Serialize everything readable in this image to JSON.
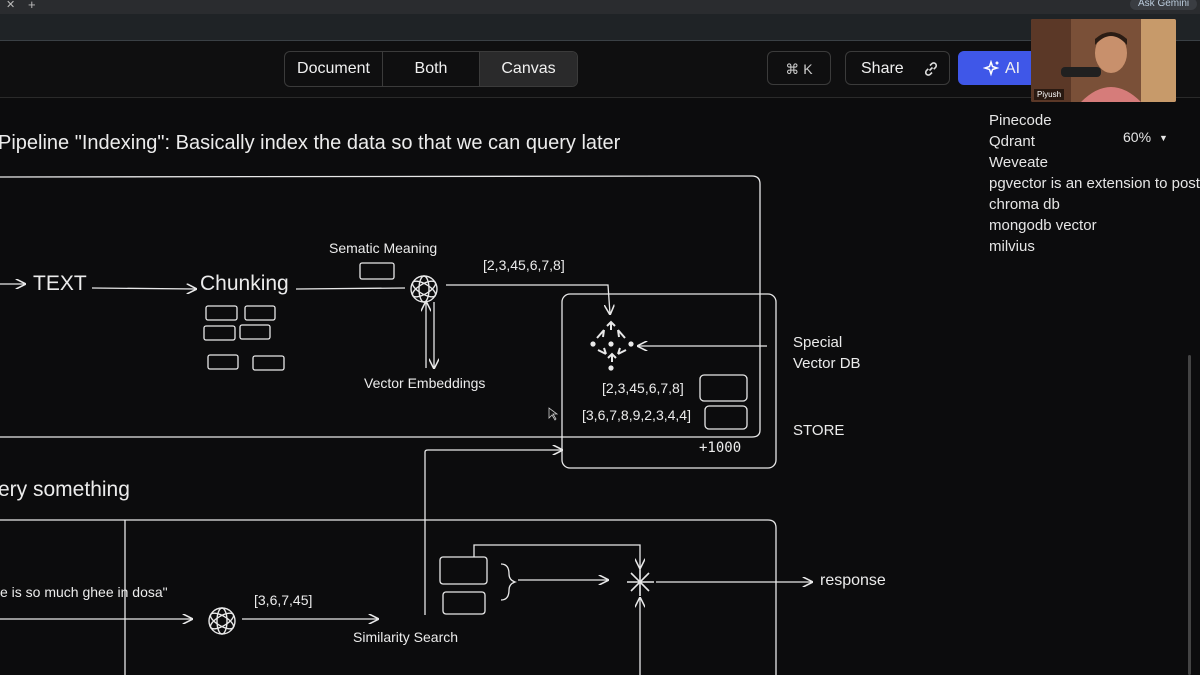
{
  "browser": {
    "ask_label": "Ask Gemini"
  },
  "toolbar": {
    "view_tabs": [
      "Document",
      "Both",
      "Canvas"
    ],
    "cmd_k_label": "⌘ K",
    "share_label": "Share",
    "ai_label": "AI"
  },
  "webcam": {
    "name": "Piyush"
  },
  "zoom": {
    "level": "60%"
  },
  "sidebar": {
    "items": [
      "Pinecode",
      "Qdrant",
      "Weveate",
      "pgvector is an extension to post",
      "chroma db",
      "mongodb vector",
      "milvius"
    ]
  },
  "diagram": {
    "title_indexing": "Pipeline \"Indexing\": Basically index the data so that we can query later",
    "text_node": "TEXT",
    "chunking_node": "Chunking",
    "semantic_label": "Sematic Meaning",
    "vector_out": "[2,3,45,6,7,8]",
    "vector_embeddings_label": "Vector Embeddings",
    "special_db_label": "Special",
    "vector_db_label": "Vector DB",
    "stored_vec_1": "[2,3,45,6,7,8]",
    "stored_vec_2": "[3,6,7,8,9,2,3,4,4]",
    "store_count": "+1000",
    "store_label": "STORE",
    "title_query": "ery something",
    "query_text": "e is so much ghee in dosa\"",
    "query_vector": "[3,6,7,45]",
    "similarity_label": "Similarity Search",
    "response_label": "response"
  },
  "colors": {
    "accent": "#3f57e8",
    "canvas_bg": "#0c0c0d",
    "stroke": "#e8e8e8"
  }
}
